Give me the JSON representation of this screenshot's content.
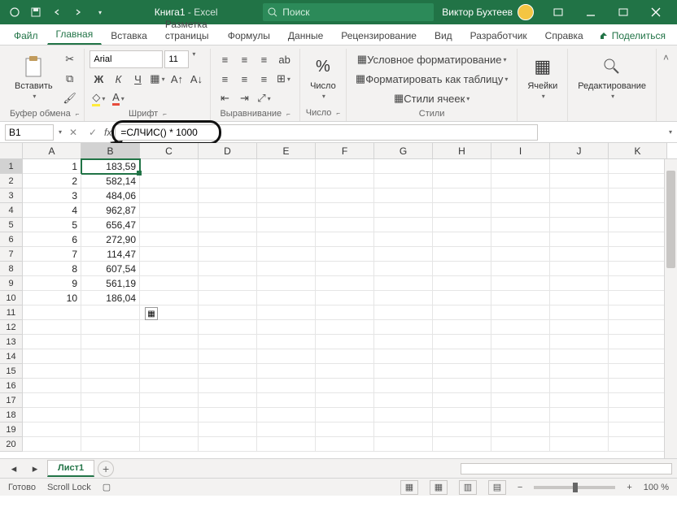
{
  "title": {
    "doc": "Книга1",
    "suffix": " - Excel"
  },
  "search_placeholder": "Поиск",
  "user_name": "Виктор Бухтеев",
  "tabs": [
    "Файл",
    "Главная",
    "Вставка",
    "Разметка страницы",
    "Формулы",
    "Данные",
    "Рецензирование",
    "Вид",
    "Разработчик",
    "Справка"
  ],
  "active_tab": 1,
  "share_label": "Поделиться",
  "ribbon": {
    "clipboard": {
      "paste": "Вставить",
      "label": "Буфер обмена"
    },
    "font": {
      "name": "Arial",
      "size": "11",
      "label": "Шрифт",
      "bold": "Ж",
      "italic": "К",
      "underline": "Ч"
    },
    "alignment": {
      "label": "Выравнивание",
      "wrap": "ab"
    },
    "number": {
      "label": "Число",
      "btn": "Число",
      "percent": "%"
    },
    "styles": {
      "label": "Стили",
      "cond": "Условное форматирование",
      "table": "Форматировать как таблицу",
      "cell": "Стили ячеек"
    },
    "cells": {
      "label": "Ячейки"
    },
    "editing": {
      "label": "Редактирование"
    }
  },
  "name_box": "B1",
  "formula": "=СЛЧИС() * 1000",
  "columns": [
    "A",
    "B",
    "C",
    "D",
    "E",
    "F",
    "G",
    "H",
    "I",
    "J",
    "K"
  ],
  "rows": [
    {
      "n": "1",
      "a": "1",
      "b": "183,59"
    },
    {
      "n": "2",
      "a": "2",
      "b": "582,14"
    },
    {
      "n": "3",
      "a": "3",
      "b": "484,06"
    },
    {
      "n": "4",
      "a": "4",
      "b": "962,87"
    },
    {
      "n": "5",
      "a": "5",
      "b": "656,47"
    },
    {
      "n": "6",
      "a": "6",
      "b": "272,90"
    },
    {
      "n": "7",
      "a": "7",
      "b": "114,47"
    },
    {
      "n": "8",
      "a": "8",
      "b": "607,54"
    },
    {
      "n": "9",
      "a": "9",
      "b": "561,19"
    },
    {
      "n": "10",
      "a": "10",
      "b": "186,04"
    },
    {
      "n": "11",
      "a": "",
      "b": ""
    },
    {
      "n": "12",
      "a": "",
      "b": ""
    },
    {
      "n": "13",
      "a": "",
      "b": ""
    },
    {
      "n": "14",
      "a": "",
      "b": ""
    },
    {
      "n": "15",
      "a": "",
      "b": ""
    },
    {
      "n": "16",
      "a": "",
      "b": ""
    },
    {
      "n": "17",
      "a": "",
      "b": ""
    },
    {
      "n": "18",
      "a": "",
      "b": ""
    },
    {
      "n": "19",
      "a": "",
      "b": ""
    },
    {
      "n": "20",
      "a": "",
      "b": ""
    }
  ],
  "sheet_name": "Лист1",
  "status": {
    "ready": "Готово",
    "scroll": "Scroll Lock",
    "zoom": "100 %"
  },
  "zoom_minus": "−",
  "zoom_plus": "+"
}
